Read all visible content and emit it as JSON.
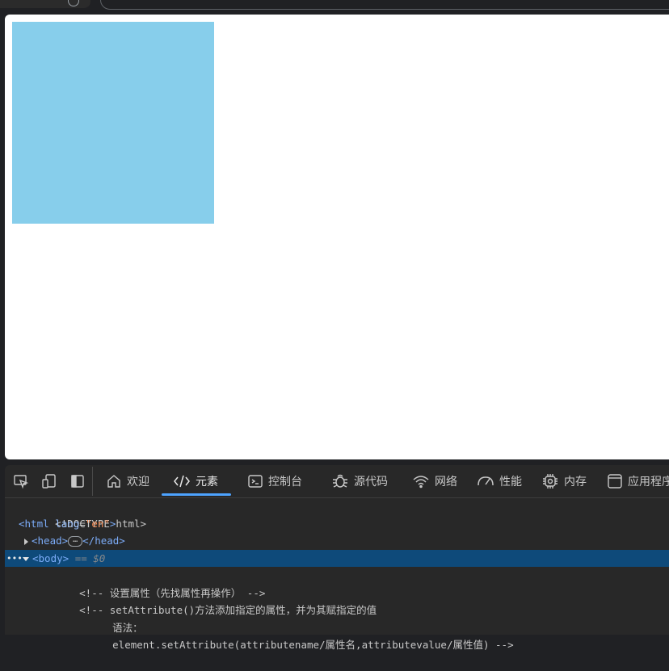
{
  "colors": {
    "box_fill": "#87ceeb",
    "devtools_bg": "#282828",
    "accent": "#4da3ff",
    "selected_row": "#0e4a7a"
  },
  "devtools": {
    "toolbar_icons": [
      "inspect-icon",
      "device-emulation-icon",
      "dock-side-icon"
    ],
    "tabs": [
      {
        "icon": "home-icon",
        "label": "欢迎"
      },
      {
        "icon": "code-icon",
        "label": "元素"
      },
      {
        "icon": "console-icon",
        "label": "控制台"
      },
      {
        "icon": "bug-icon",
        "label": "源代码"
      },
      {
        "icon": "wifi-icon",
        "label": "网络"
      },
      {
        "icon": "gauge-icon",
        "label": "性能"
      },
      {
        "icon": "chip-icon",
        "label": "内存"
      },
      {
        "icon": "app-window-icon",
        "label": "应用程序"
      }
    ],
    "active_tab": "元素",
    "dom": {
      "doctype": "<!DOCTYPE html>",
      "html_open": "<html",
      "html_attr_name": "lang",
      "html_attr_value": "\"en\"",
      "html_close_bracket": ">",
      "head_open": "<head>",
      "head_ellipsis": "…",
      "head_close": "</head>",
      "body_tag": "<body>",
      "body_marker": "== $0",
      "selected_dots": "•••",
      "comment_1": "<!-- 设置属性（先找属性再操作） -->",
      "comment_2": "<!-- setAttribute()方法添加指定的属性，并为其赋指定的值",
      "comment_3": "语法：",
      "comment_4": "element.setAttribute(attributename/属性名,attributevalue/属性值) -->"
    }
  }
}
